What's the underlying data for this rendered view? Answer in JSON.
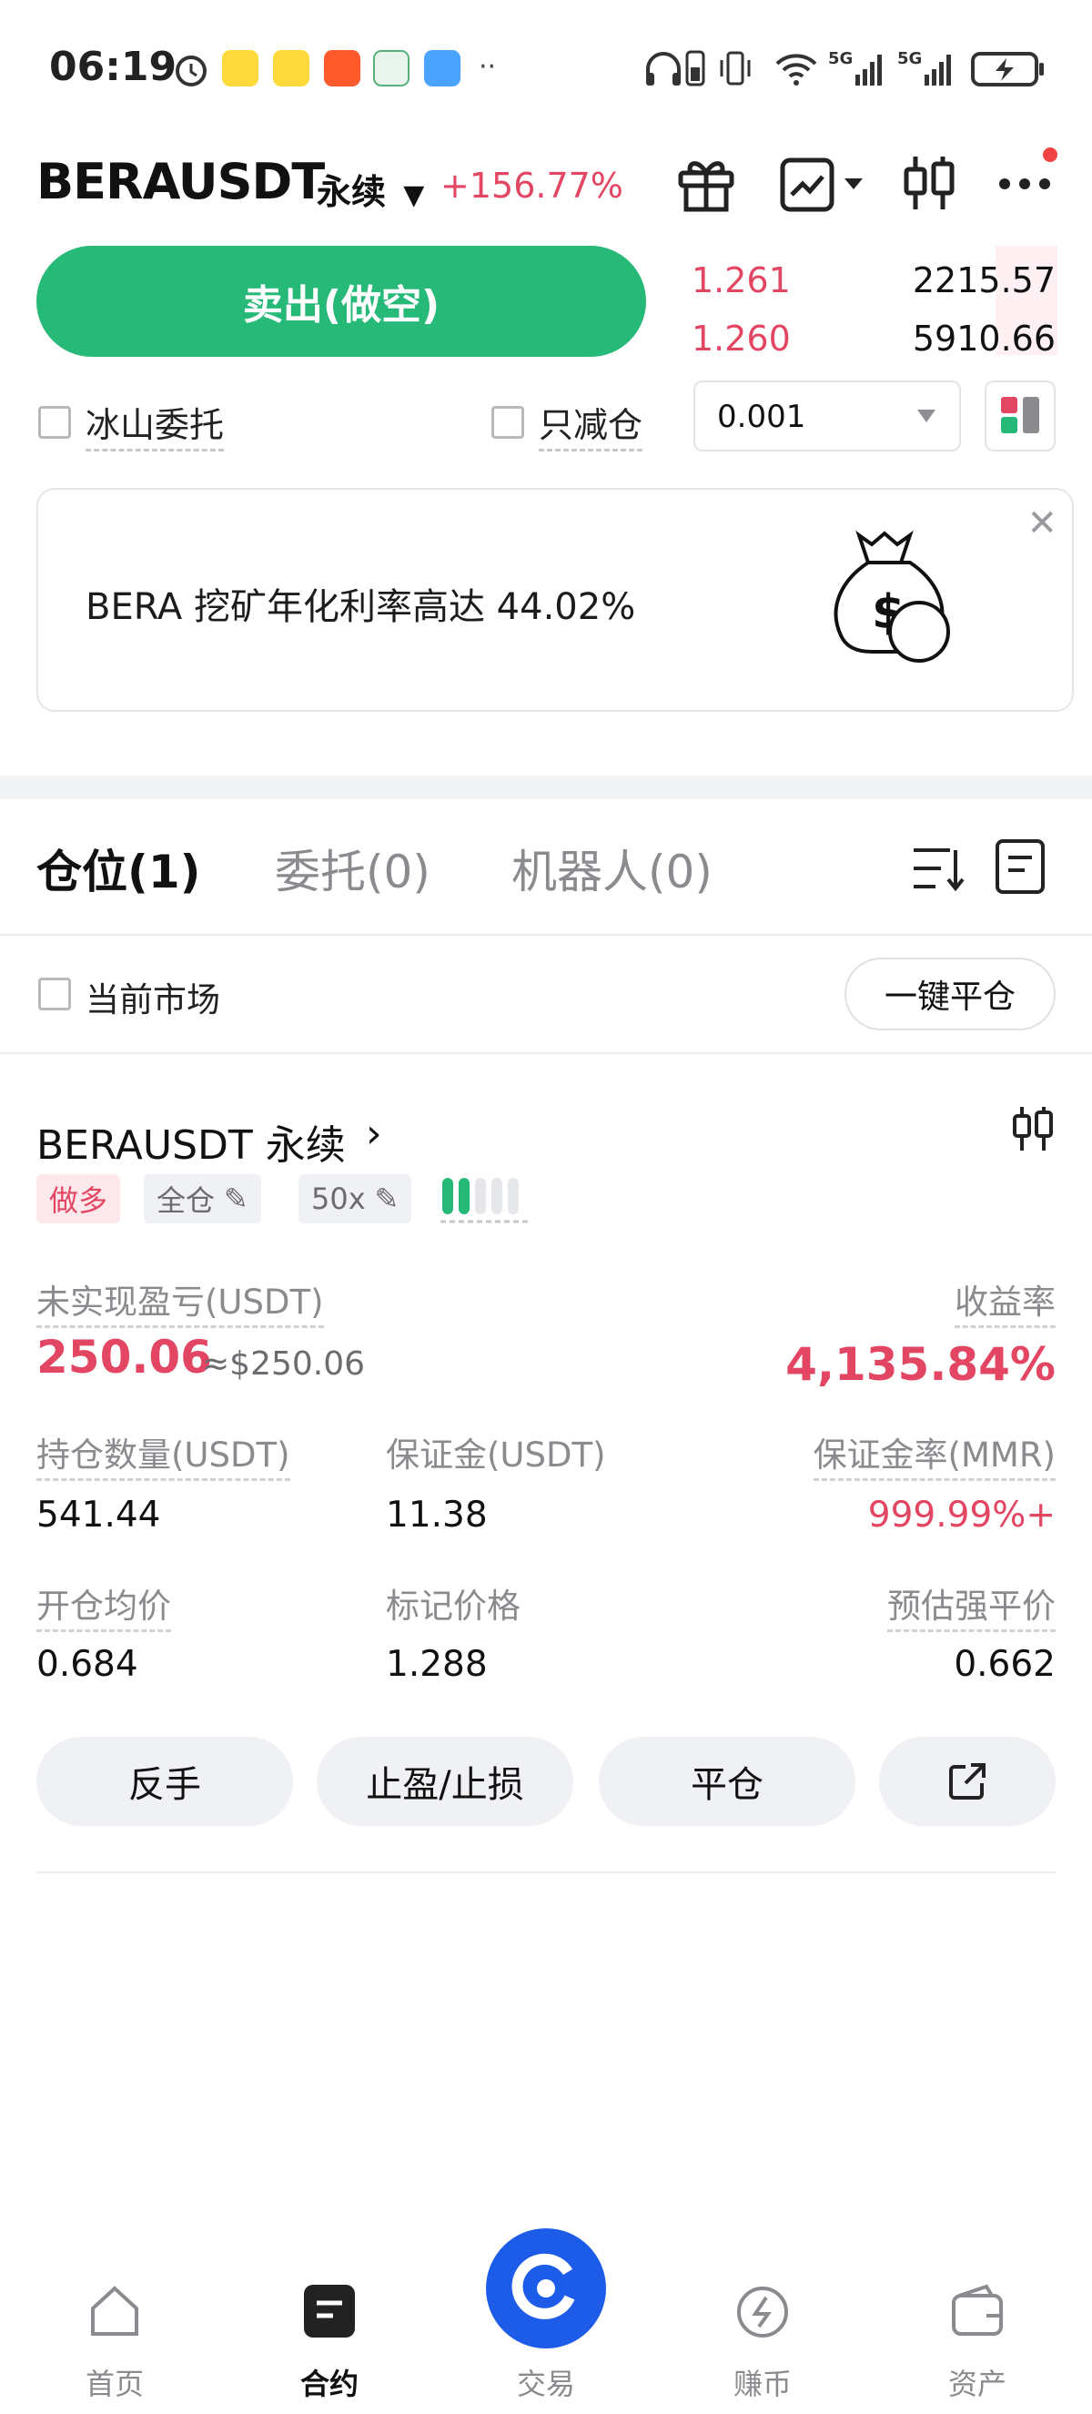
{
  "status_bar": {
    "time": "06:19"
  },
  "header": {
    "symbol": "BERAUSDT",
    "contract_type": "永续",
    "change": "+156.77%"
  },
  "order_panel": {
    "sell_label": "卖出(做空)",
    "orderbook": [
      {
        "price": "1.261",
        "qty": "2215.57"
      },
      {
        "price": "1.260",
        "qty": "5910.66"
      }
    ],
    "iceberg_label": "冰山委托",
    "reduce_only_label": "只减仓",
    "precision_value": "0.001"
  },
  "banner": {
    "text": "BERA 挖矿年化利率高达 44.02%"
  },
  "tabs": [
    {
      "label": "仓位(1)",
      "active": true
    },
    {
      "label": "委托(0)",
      "active": false
    },
    {
      "label": "机器人(0)",
      "active": false
    }
  ],
  "filter": {
    "current_market_label": "当前市场",
    "close_all_label": "一键平仓"
  },
  "position": {
    "title": "BERAUSDT 永续",
    "side_tag": "做多",
    "margin_mode_tag": "全仓",
    "leverage_tag": "50x",
    "unrealized_pnl_label": "未实现盈亏(USDT)",
    "unrealized_pnl": "250.06",
    "unrealized_pnl_usd": "≈$250.06",
    "roi_label": "收益率",
    "roi": "4,135.84%",
    "size_label": "持仓数量(USDT)",
    "size": "541.44",
    "margin_label": "保证金(USDT)",
    "margin": "11.38",
    "mmr_label": "保证金率(MMR)",
    "mmr": "999.99%+",
    "entry_label": "开仓均价",
    "entry": "0.684",
    "mark_label": "标记价格",
    "mark": "1.288",
    "liq_label": "预估强平价",
    "liq": "0.662",
    "actions": {
      "reverse": "反手",
      "tpsl": "止盈/止损",
      "close": "平仓"
    }
  },
  "nav": [
    {
      "label": "首页",
      "icon": "home-icon"
    },
    {
      "label": "合约",
      "icon": "contract-icon"
    },
    {
      "label": "交易",
      "icon": "trade-icon"
    },
    {
      "label": "赚币",
      "icon": "earn-icon"
    },
    {
      "label": "资产",
      "icon": "wallet-icon"
    }
  ],
  "colors": {
    "buy_green": "#26b978",
    "sell_red": "#e24663",
    "brand_blue": "#1d5ce8"
  }
}
